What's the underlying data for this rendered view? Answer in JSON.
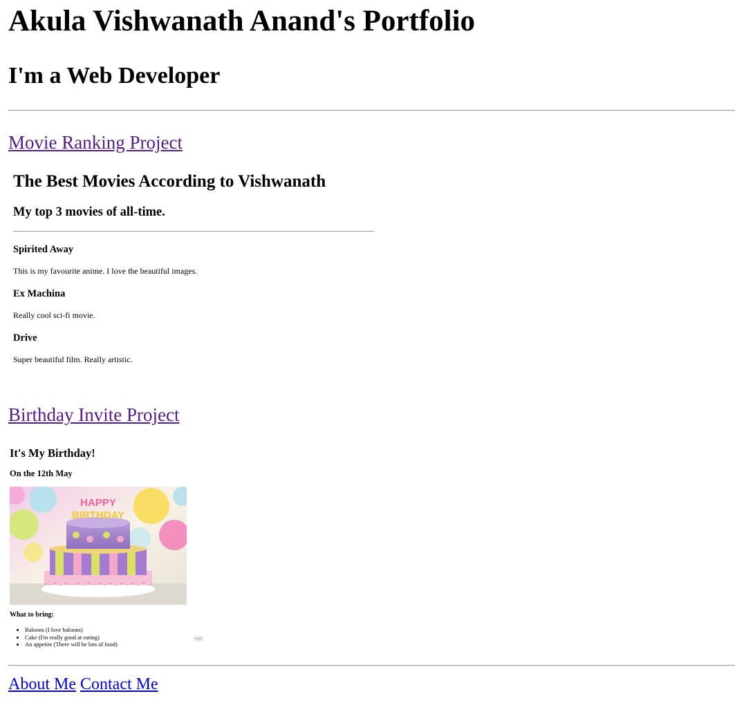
{
  "header": {
    "title": "Akula Vishwanath Anand's Portfolio",
    "subtitle": "I'm a Web Developer"
  },
  "projects": [
    {
      "link_label": "Movie Ranking Project"
    },
    {
      "link_label": "Birthday Invite Project"
    }
  ],
  "movie_project": {
    "heading": "The Best Movies According to Vishwanath",
    "subheading": "My top 3 movies of all-time.",
    "movies": [
      {
        "title": "Spirited Away",
        "description": "This is my favourite anime. I love the beautiful images."
      },
      {
        "title": "Ex Machina",
        "description": "Really cool sci-fi movie."
      },
      {
        "title": "Drive",
        "description": "Super beautiful film. Really artistic."
      }
    ]
  },
  "birthday_project": {
    "heading": "It's My Birthday!",
    "date_line": "On the 12th May",
    "image_icon": "birthday-cake-image",
    "bring_heading": "What to bring:",
    "items": [
      "Baloons (I love baloons)",
      "Cake (I'm really good at eating)",
      "An appetite (There will be lots of food)"
    ],
    "corner_label": "Forms"
  },
  "footer": {
    "about_label": "About Me",
    "contact_label": "Contact Me"
  },
  "colors": {
    "visited_link": "#551a8b",
    "link": "#0000ee",
    "rule": "#9a9a9a"
  }
}
